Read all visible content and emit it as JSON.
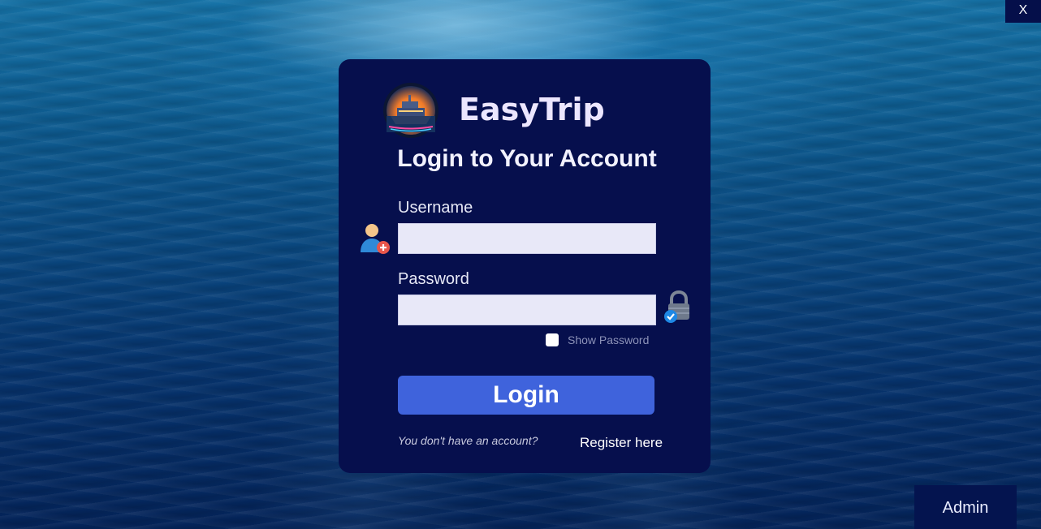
{
  "window": {
    "close_label": "X"
  },
  "brand": {
    "name": "EasyTrip",
    "logo_icon": "cruise-ship-logo"
  },
  "login": {
    "title": "Login to Your Account",
    "username_label": "Username",
    "username_value": "",
    "password_label": "Password",
    "password_value": "",
    "show_password_label": "Show Password",
    "show_password_checked": false,
    "login_button": "Login",
    "no_account_text": "You don't have an account?",
    "register_link": "Register here"
  },
  "footer": {
    "admin_button": "Admin"
  },
  "colors": {
    "card_bg": "#060f4d",
    "accent": "#3f63dc",
    "input_bg": "#e8e8f8"
  }
}
